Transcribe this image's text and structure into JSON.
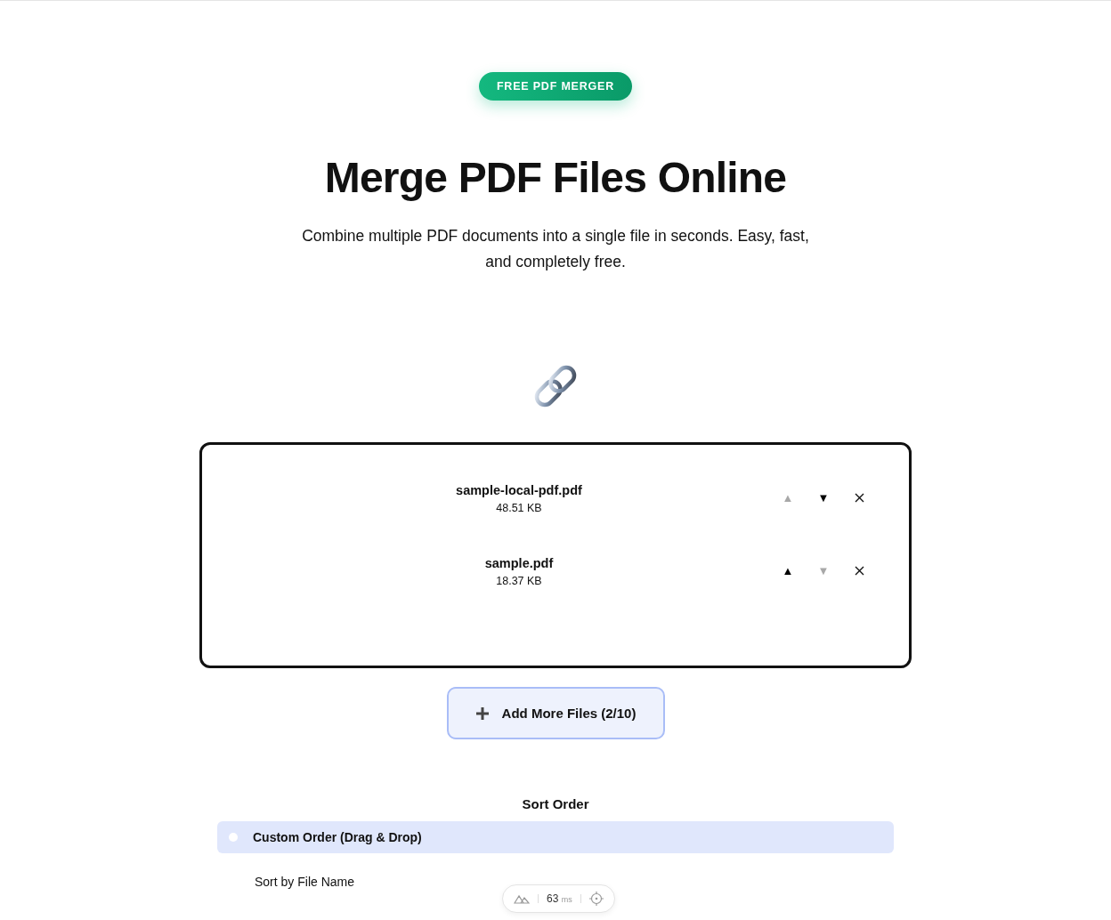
{
  "badge": "FREE PDF MERGER",
  "title": "Merge PDF Files Online",
  "subtitle": "Combine multiple PDF documents into a single file in seconds. Easy, fast, and completely free.",
  "files": [
    {
      "name": "sample-local-pdf.pdf",
      "size": "48.51 KB",
      "up": {
        "label": "▲",
        "disabled": true
      },
      "down": {
        "label": "▼",
        "disabled": false
      }
    },
    {
      "name": "sample.pdf",
      "size": "18.37 KB",
      "up": {
        "label": "▲",
        "disabled": false
      },
      "down": {
        "label": "▼",
        "disabled": true
      }
    }
  ],
  "add_button": "Add More Files (2/10)",
  "sort": {
    "heading": "Sort Order",
    "options": [
      {
        "label": "Custom Order (Drag & Drop)",
        "selected": true
      },
      {
        "label": "Sort by File Name",
        "selected": false
      }
    ]
  },
  "devtools": {
    "timing": "63",
    "unit": "ms"
  }
}
